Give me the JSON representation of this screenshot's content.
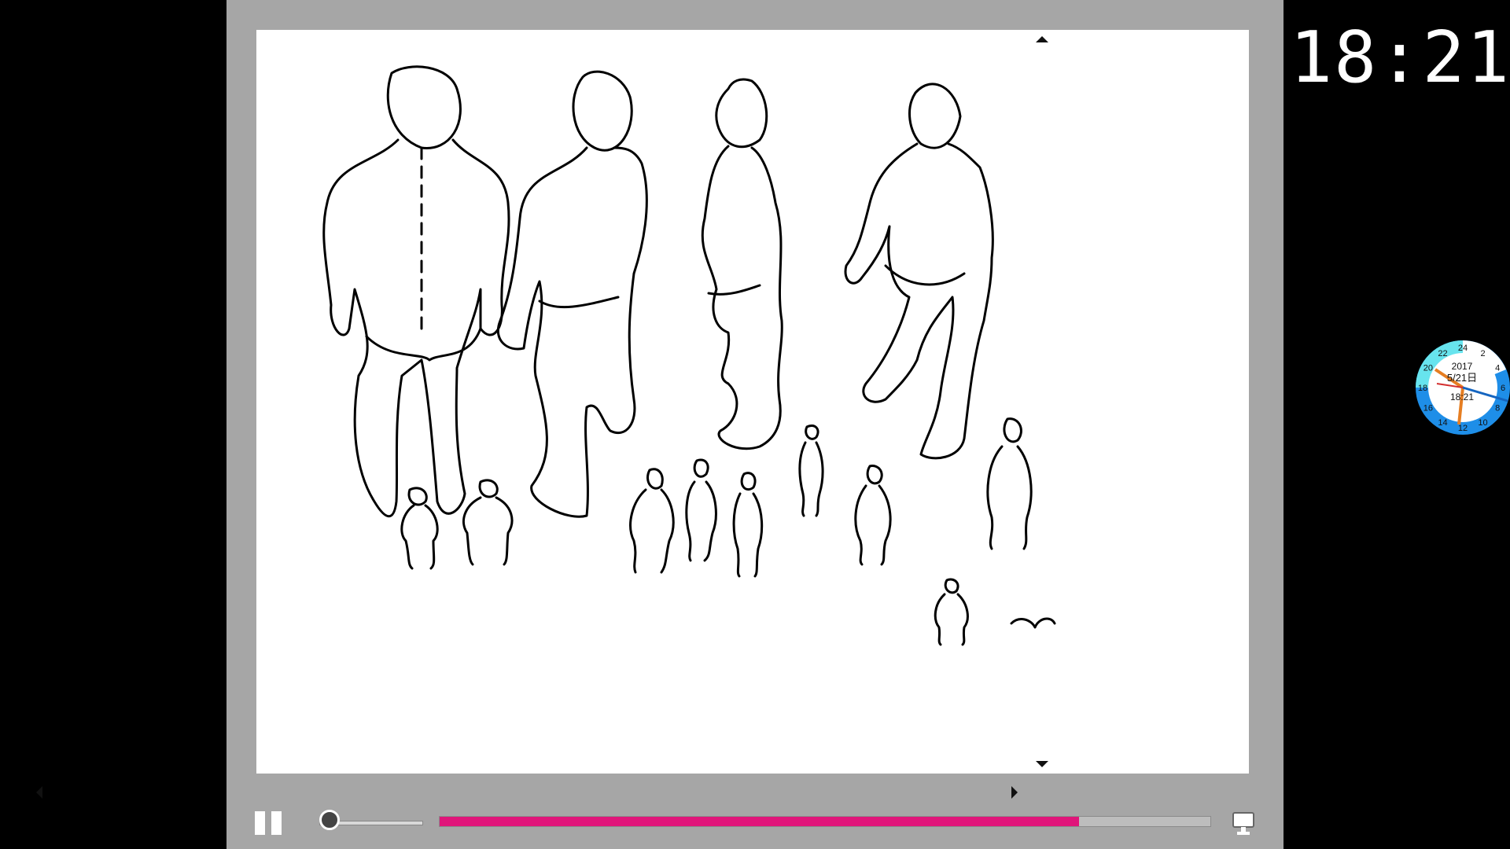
{
  "clock": {
    "time": "18:21"
  },
  "dial": {
    "year": "2017",
    "date": "5/21日",
    "time": "18:21",
    "hours": [
      "24",
      "2",
      "4",
      "6",
      "8",
      "10",
      "12",
      "14",
      "16",
      "18",
      "20",
      "22"
    ]
  },
  "player": {
    "state": "playing",
    "volume_fraction": 0.1,
    "progress_fraction": 0.83
  },
  "colors": {
    "frame": "#a6a6a6",
    "progress": "#e0157a",
    "dial_blue": "#1e8ee8",
    "dial_cyan": "#67e4ee"
  }
}
